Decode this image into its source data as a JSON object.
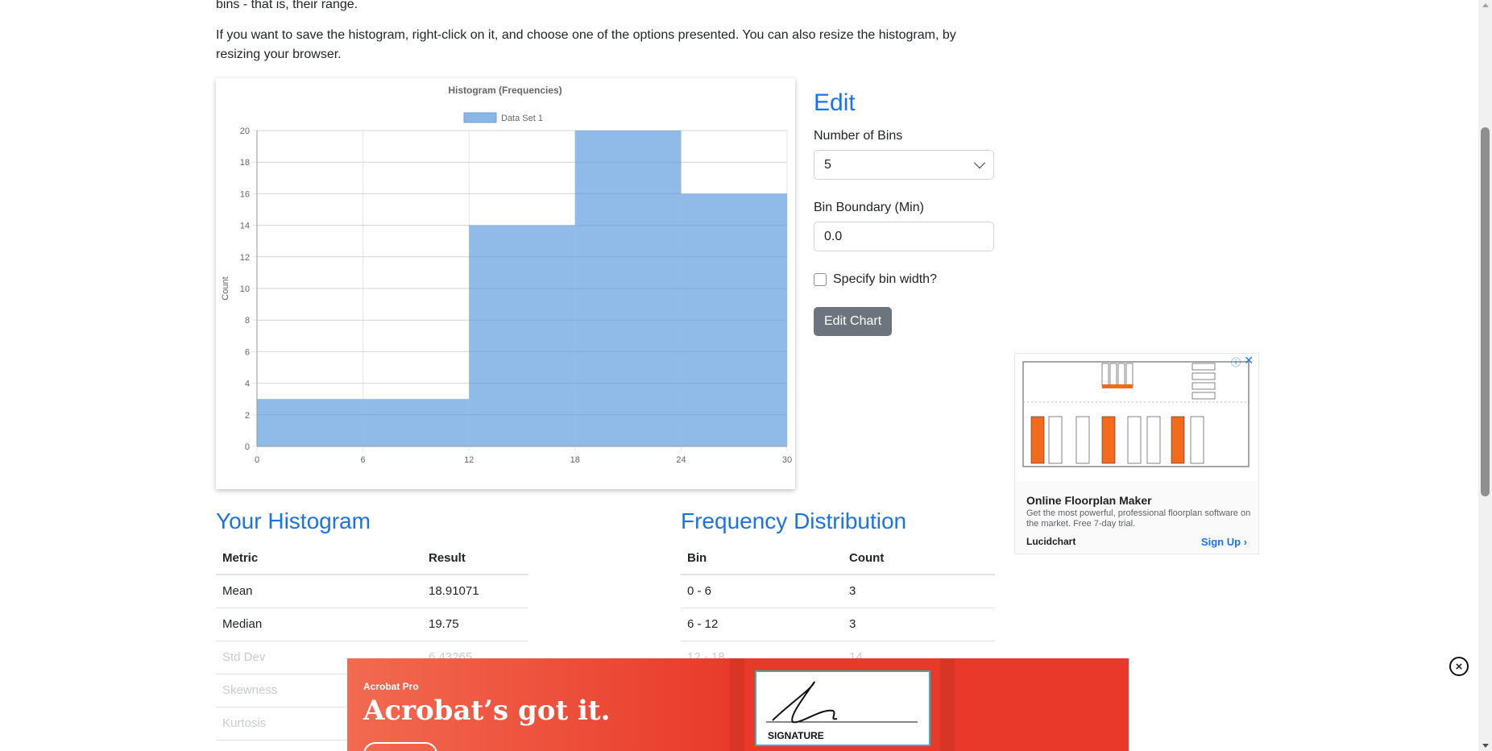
{
  "intro": {
    "line1": "bins - that is, their range.",
    "line2": "If you want to save the histogram, right-click on it, and choose one of the options presented. You can also resize the histogram, by resizing your browser."
  },
  "chart_data": {
    "type": "bar",
    "title": "Histogram (Frequencies)",
    "ylabel": "Count",
    "xlabel": "",
    "x_ticks": [
      "0",
      "6",
      "12",
      "18",
      "24",
      "30"
    ],
    "y_ticks": [
      "0",
      "2",
      "4",
      "6",
      "8",
      "10",
      "12",
      "14",
      "16",
      "18",
      "20"
    ],
    "bins": [
      [
        0,
        6
      ],
      [
        6,
        12
      ],
      [
        12,
        18
      ],
      [
        18,
        24
      ],
      [
        24,
        30
      ]
    ],
    "series": [
      {
        "name": "Data Set 1",
        "values": [
          3,
          3,
          14,
          20,
          16
        ]
      }
    ],
    "xlim": [
      0,
      30
    ],
    "ylim": [
      0,
      20
    ],
    "grid": true,
    "legend": "top-center",
    "bar_color": "#8ab6e6"
  },
  "edit": {
    "title": "Edit",
    "bins_label": "Number of Bins",
    "bins_value": "5",
    "boundary_label": "Bin Boundary (Min)",
    "boundary_value": "0.0",
    "specify_width_label": "Specify bin width?",
    "button": "Edit Chart"
  },
  "ad": {
    "title": "Online Floorplan Maker",
    "description": "Get the most powerful, professional floorplan software on the market. Free 7-day trial.",
    "brand": "Lucidchart",
    "cta": "Sign Up"
  },
  "your_histogram": {
    "title": "Your Histogram",
    "headers": [
      "Metric",
      "Result"
    ],
    "rows": [
      [
        "Mean",
        "18.91071"
      ],
      [
        "Median",
        "19.75"
      ],
      [
        "Std Dev",
        "6.43265"
      ],
      [
        "Skewness",
        ""
      ],
      [
        "Kurtosis",
        ""
      ]
    ]
  },
  "frequency": {
    "title": "Frequency Distribution",
    "headers": [
      "Bin",
      "Count"
    ],
    "rows": [
      [
        "0 - 6",
        "3"
      ],
      [
        "6 - 12",
        "3"
      ],
      [
        "12 - 18",
        "14"
      ]
    ]
  },
  "bottom_ad": {
    "brand": "Acrobat Pro",
    "headline": "Acrobat’s got it.",
    "signature_label": "SIGNATURE"
  },
  "colors": {
    "accent": "#1a73e8",
    "button": "#6c757d",
    "bar": "#8ab6e6",
    "ad_red": "#e8392a"
  }
}
